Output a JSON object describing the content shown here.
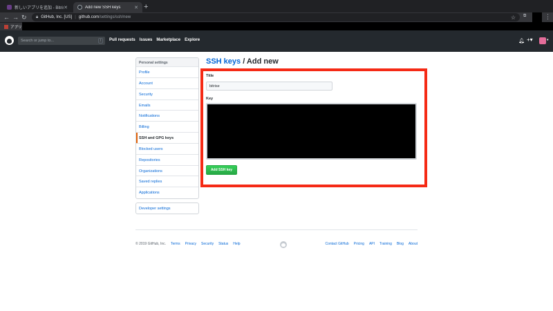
{
  "browser": {
    "tabs": [
      {
        "title": "新しいアプリを追加 - Bitrise",
        "favicon_color": "#683d87"
      },
      {
        "title": "Add new SSH keys",
        "favicon_color": "#24292e"
      }
    ],
    "address": {
      "org": "GitHub, Inc. [US]",
      "host": "github.com",
      "path": "/settings/ssh/new"
    },
    "bookmarks": [
      {
        "label": "アプリ"
      }
    ]
  },
  "gh_header": {
    "search_placeholder": "Search or jump to...",
    "search_shortcut": "/",
    "nav": [
      "Pull requests",
      "Issues",
      "Marketplace",
      "Explore"
    ],
    "plus": "+▾",
    "avatar_color": "#e36d9a"
  },
  "sidebar": {
    "heading": "Personal settings",
    "items": [
      {
        "label": "Profile"
      },
      {
        "label": "Account"
      },
      {
        "label": "Security"
      },
      {
        "label": "Emails"
      },
      {
        "label": "Notifications"
      },
      {
        "label": "Billing"
      },
      {
        "label": "SSH and GPG keys",
        "selected": true
      },
      {
        "label": "Blocked users"
      },
      {
        "label": "Repositories"
      },
      {
        "label": "Organizations"
      },
      {
        "label": "Saved replies"
      },
      {
        "label": "Applications"
      }
    ],
    "developer_settings": "Developer settings"
  },
  "main": {
    "breadcrumb_link": "SSH keys",
    "breadcrumb_rest": "/ Add new",
    "form": {
      "title_label": "Title",
      "title_value": "bitrise",
      "key_label": "Key",
      "key_value": "",
      "submit_label": "Add SSH key"
    },
    "highlight_color": "#f52a15"
  },
  "footer": {
    "copyright": "© 2019 GitHub, Inc.",
    "left_links": [
      "Terms",
      "Privacy",
      "Security",
      "Status",
      "Help"
    ],
    "right_links": [
      "Contact GitHub",
      "Pricing",
      "API",
      "Training",
      "Blog",
      "About"
    ]
  }
}
